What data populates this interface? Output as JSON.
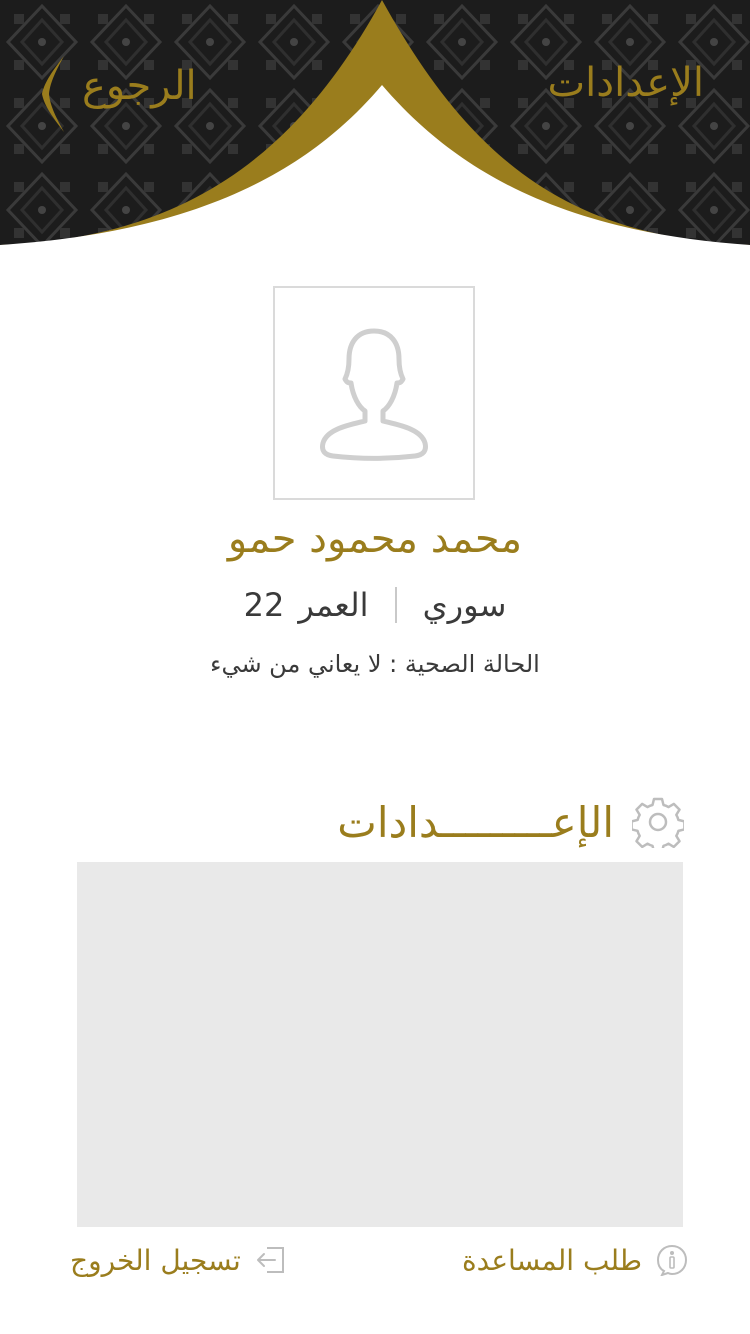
{
  "header": {
    "title": "الإعدادات",
    "back_label": "الرجوع",
    "colors": {
      "gold": "#9a7d1d",
      "dark_pattern": "#1a1a1a"
    }
  },
  "profile": {
    "avatar_icon": "person-silhouette-icon",
    "name": "محمد محمود حمو",
    "nationality": "سوري",
    "age_label": "العمر",
    "age_value": "22",
    "health_status": "الحالة الصحية : لا يعاني من شيء"
  },
  "settings": {
    "icon": "gear-icon",
    "heading": "الإعـــــــــدادات"
  },
  "footer": {
    "help_label": "طلب المساعدة",
    "help_icon": "info-bubble-icon",
    "logout_label": "تسجيل الخروج",
    "logout_icon": "logout-icon"
  }
}
